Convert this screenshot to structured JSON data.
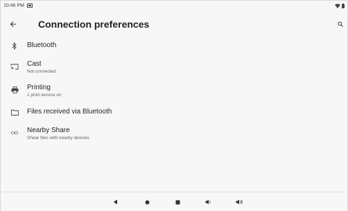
{
  "status_bar": {
    "time": "10:46 PM",
    "icons": [
      "notification-icon",
      "wifi-icon",
      "battery-icon"
    ]
  },
  "app_bar": {
    "title": "Connection preferences",
    "back_icon": "arrow-back-icon",
    "search_icon": "search-icon"
  },
  "items": [
    {
      "title": "Bluetooth",
      "summary": "",
      "icon": "bluetooth-icon"
    },
    {
      "title": "Cast",
      "summary": "Not connected",
      "icon": "cast-icon"
    },
    {
      "title": "Printing",
      "summary": "1 print service on",
      "icon": "printer-icon"
    },
    {
      "title": "Files received via Bluetooth",
      "summary": "",
      "icon": "folder-icon"
    },
    {
      "title": "Nearby Share",
      "summary": "Shear files with nearby devices",
      "icon": "nearby-share-icon"
    }
  ],
  "nav_bar": {
    "buttons": [
      "back-triangle-icon",
      "home-circle-icon",
      "recents-square-icon",
      "volume-down-icon",
      "volume-up-icon"
    ]
  },
  "colors": {
    "background": "#f7f7f7",
    "text_primary": "#1f1f1f",
    "text_secondary": "#5f5f5f",
    "icon": "#444444"
  }
}
